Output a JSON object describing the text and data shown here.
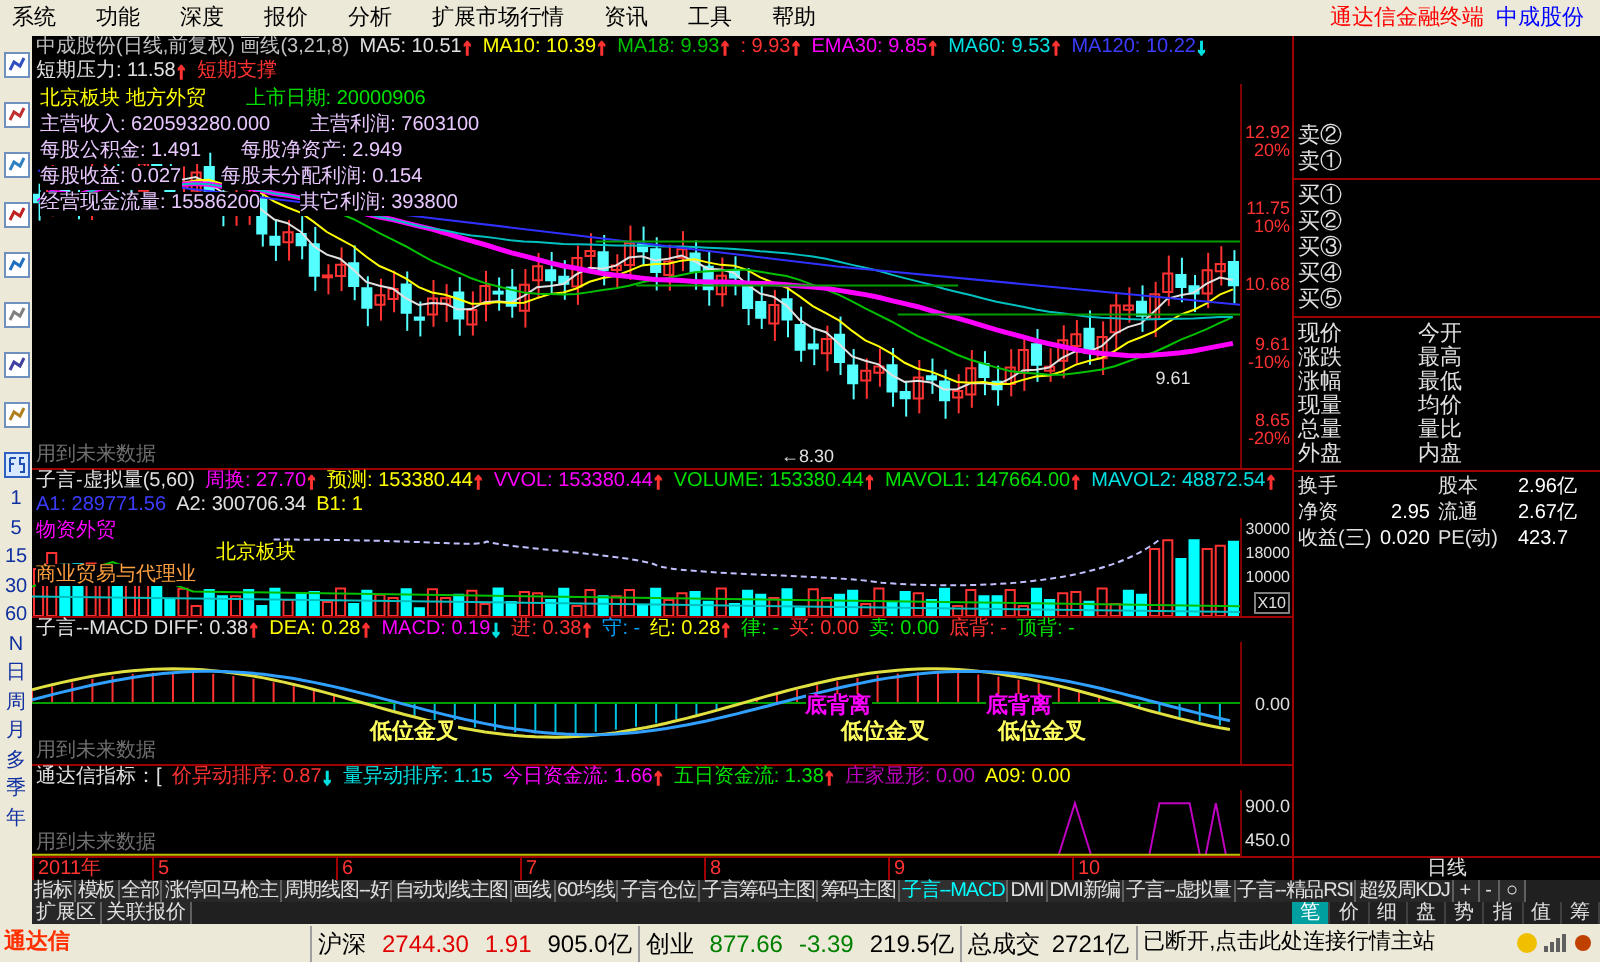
{
  "menu": [
    "系统",
    "功能",
    "深度",
    "报价",
    "分析",
    "扩展市场行情",
    "资讯",
    "工具",
    "帮助"
  ],
  "brand": {
    "terminal": "通达信金融终端",
    "stock": "中成股份"
  },
  "left_toolbar": {
    "periods": [
      "1",
      "5",
      "15",
      "30",
      "60",
      "N",
      "日",
      "周",
      "月",
      "多",
      "季",
      "年"
    ]
  },
  "main_chart": {
    "header": [
      {
        "text": "中成股份(日线,前复权) 画线(3,21,8)",
        "color": "#c0c0c0"
      },
      {
        "text": "MA5: 10.51",
        "color": "#e0e0e0",
        "arrow": {
          "text": "↑",
          "color": "#ff3232"
        }
      },
      {
        "text": "MA10: 10.39",
        "color": "#ffff00",
        "arrow": {
          "text": "↑",
          "color": "#ff3232"
        }
      },
      {
        "text": "MA18: 9.93",
        "color": "#00c000",
        "arrow": {
          "text": "↑",
          "color": "#ff3232"
        }
      },
      {
        "text": ": 9.93",
        "color": "#ff3232",
        "arrow": {
          "text": "↑",
          "color": "#ff3232"
        }
      },
      {
        "text": "EMA30: 9.85",
        "color": "#ff00ff",
        "arrow": {
          "text": "↑",
          "color": "#ff3232"
        }
      },
      {
        "text": "MA60: 9.53",
        "color": "#00e0e0",
        "arrow": {
          "text": "↑",
          "color": "#ff3232"
        }
      },
      {
        "text": "MA120: 10.22",
        "color": "#3c3cff",
        "arrow": {
          "text": "↓",
          "color": "#00e0e0"
        }
      },
      {
        "text": "短期压力: 11.58",
        "color": "#e0e0e0",
        "arrow": {
          "text": "↑",
          "color": "#ff3232"
        }
      },
      {
        "text": "短期支撑",
        "color": "#ff3232"
      }
    ],
    "info": [
      [
        {
          "text": "北京板块 地方外贸",
          "color": "#ffff00"
        },
        {
          "text": "上市日期: 20000906",
          "color": "#00e000"
        }
      ],
      [
        {
          "text": "主营收入: 620593280.000",
          "color": "#e8c8ff"
        },
        {
          "text": "主营利润: 7603100",
          "color": "#e8c8ff"
        }
      ],
      [
        {
          "text": "每股公积金: 1.491",
          "color": "#e8c8ff"
        },
        {
          "text": "每股净资产: 2.949",
          "color": "#e8c8ff"
        }
      ],
      [
        {
          "text": "每股收益: 0.027",
          "color": "#e8c8ff"
        },
        {
          "text": "每股未分配利润: 0.154",
          "color": "#e8c8ff"
        }
      ],
      [
        {
          "text": "经营现金流量: 15586200",
          "color": "#e8c8ff"
        },
        {
          "text": "其它利润: 393800",
          "color": "#e8c8ff"
        }
      ]
    ],
    "axis": [
      {
        "price": "12.92",
        "pct": "20%"
      },
      {
        "price": "11.75",
        "pct": "10%"
      },
      {
        "price": "10.68"
      },
      {
        "price": "9.61",
        "pct": "-10%"
      },
      {
        "price": "8.65",
        "pct": "-20%"
      }
    ],
    "low_marker": "←8.30",
    "last_marker": "9.61",
    "note": "用到未来数据"
  },
  "volume": {
    "header": [
      {
        "text": "子言-虚拟量(5,60)",
        "color": "#e0e0e0"
      },
      {
        "text": "周换: 27.70",
        "color": "#ff00ff",
        "arrow": {
          "text": "↑",
          "color": "#ff3232"
        }
      },
      {
        "text": "预测: 153380.44",
        "color": "#ffff00",
        "arrow": {
          "text": "↑",
          "color": "#ff3232"
        }
      },
      {
        "text": "VVOL: 153380.44",
        "color": "#ff00ff",
        "arrow": {
          "text": "↑",
          "color": "#ff3232"
        }
      },
      {
        "text": "VOLUME: 153380.44",
        "color": "#00e000",
        "arrow": {
          "text": "↑",
          "color": "#ff3232"
        }
      },
      {
        "text": "MAVOL1: 147664.00",
        "color": "#00e000",
        "arrow": {
          "text": "↑",
          "color": "#ff3232"
        }
      },
      {
        "text": "MAVOL2: 48872.54",
        "color": "#00e0e0",
        "arrow": {
          "text": "↑",
          "color": "#ff3232"
        }
      },
      {
        "text": "A1: 289771.56",
        "color": "#3c3cff"
      },
      {
        "text": "A2: 300706.34",
        "color": "#e0e0e0"
      },
      {
        "text": "B1: 1",
        "color": "#ffff00"
      }
    ],
    "overlay": [
      {
        "text": "物资外贸",
        "color": "#ff00ff"
      },
      {
        "text": "北京板块",
        "color": "#ffff00"
      },
      {
        "text": "商业贸易与代理业",
        "color": "#ffa040"
      }
    ],
    "axis": [
      "30000",
      "18000",
      "10000"
    ],
    "unit": "X10"
  },
  "macd": {
    "header": [
      {
        "text": "子言--MACD DIFF: 0.38",
        "color": "#e0e0e0",
        "arrow": {
          "text": "↑",
          "color": "#ff3232"
        }
      },
      {
        "text": "DEA: 0.28",
        "color": "#ffff00",
        "arrow": {
          "text": "↑",
          "color": "#ff3232"
        }
      },
      {
        "text": "MACD: 0.19",
        "color": "#ff00ff",
        "arrow": {
          "text": "↓",
          "color": "#00e0e0"
        }
      },
      {
        "text": "进: 0.38",
        "color": "#ff3232",
        "arrow": {
          "text": "↑",
          "color": "#ff3232"
        }
      },
      {
        "text": "守: -",
        "color": "#00a0ff"
      },
      {
        "text": "纪: 0.28",
        "color": "#ffff00",
        "arrow": {
          "text": "↑",
          "color": "#ff3232"
        }
      },
      {
        "text": "律: -",
        "color": "#00e000"
      },
      {
        "text": "买: 0.00",
        "color": "#ff3232"
      },
      {
        "text": "卖: 0.00",
        "color": "#00e000"
      },
      {
        "text": "底背: -",
        "color": "#ff3232"
      },
      {
        "text": "顶背: -",
        "color": "#00e000"
      }
    ],
    "labels": [
      {
        "text": "低位金叉",
        "color": "#ffff60"
      },
      {
        "text": "底背离",
        "color": "#ff00ff"
      },
      {
        "text": "低位金叉",
        "color": "#ffff60"
      },
      {
        "text": "底背离",
        "color": "#ff00ff"
      },
      {
        "text": "低位金叉",
        "color": "#ffff60"
      }
    ],
    "axis": [
      "0.00"
    ],
    "note": "用到未来数据"
  },
  "tdx": {
    "header": [
      {
        "text": "通达信指标：[",
        "color": "#e0e0e0"
      },
      {
        "text": "价异动排序: 0.87",
        "color": "#ff3232",
        "arrow": {
          "text": "↓",
          "color": "#00e0e0"
        }
      },
      {
        "text": "量异动排序: 1.15",
        "color": "#00e0e0"
      },
      {
        "text": "今日资金流: 1.66",
        "color": "#ff00ff",
        "arrow": {
          "text": "↑",
          "color": "#ff3232"
        }
      },
      {
        "text": "五日资金流: 1.38",
        "color": "#00e000",
        "arrow": {
          "text": "↑",
          "color": "#ff3232"
        }
      },
      {
        "text": "庄家显形: 0.00",
        "color": "#c000c0"
      },
      {
        "text": "A09: 0.00",
        "color": "#ffff00"
      }
    ],
    "axis": [
      "900.0",
      "450.0"
    ],
    "note": "用到未来数据"
  },
  "dates": [
    "2011年",
    "5",
    "6",
    "7",
    "8",
    "9",
    "10"
  ],
  "period_label": "日线",
  "tabs": [
    {
      "label": "指标",
      "selected": false
    },
    {
      "label": "模板",
      "selected": false
    },
    {
      "label": "全部",
      "selected": false
    },
    {
      "label": "涨停回马枪主",
      "selected": false
    },
    {
      "label": "周期线图--好",
      "selected": false
    },
    {
      "label": "自动划线主图",
      "selected": false
    },
    {
      "label": "画线",
      "selected": false
    },
    {
      "label": "60均线",
      "selected": false
    },
    {
      "label": "子言仓位",
      "selected": false
    },
    {
      "label": "子言筹码主图",
      "selected": false
    },
    {
      "label": "筹码主图",
      "selected": false
    },
    {
      "label": "子言--MACD",
      "selected": true
    },
    {
      "label": "DMI",
      "selected": false
    },
    {
      "label": "DMI新编",
      "selected": false
    },
    {
      "label": "子言--虚拟量",
      "selected": false
    },
    {
      "label": "子言--精品RSI",
      "selected": false
    },
    {
      "label": "超级周KDJ",
      "selected": false
    }
  ],
  "zoom_buttons": [
    "+",
    "-",
    "○"
  ],
  "sub_tabs": [
    "扩展区",
    "关联报价"
  ],
  "quote": {
    "sell": [
      "卖②",
      "卖①"
    ],
    "buy": [
      "买①",
      "买②",
      "买③",
      "买④",
      "买⑤"
    ],
    "fields": [
      [
        "现价",
        "今开"
      ],
      [
        "涨跌",
        "最高"
      ],
      [
        "涨幅",
        "最低"
      ],
      [
        "现量",
        "均价"
      ],
      [
        "总量",
        "量比"
      ],
      [
        "外盘",
        "内盘"
      ]
    ],
    "stats": [
      {
        "label": "换手",
        "label2": "股本",
        "value2": "2.96亿"
      },
      {
        "label": "净资",
        "value": "2.95",
        "label2": "流通",
        "value2": "2.67亿"
      },
      {
        "label": "收益(三)",
        "value": "0.020",
        "label2": "PE(动)",
        "value2": "423.7"
      }
    ]
  },
  "side_tabs": [
    {
      "label": "笔",
      "selected": true
    },
    {
      "label": "价",
      "selected": false
    },
    {
      "label": "细",
      "selected": false
    },
    {
      "label": "盘",
      "selected": false
    },
    {
      "label": "势",
      "selected": false
    },
    {
      "label": "指",
      "selected": false
    },
    {
      "label": "值",
      "selected": false
    },
    {
      "label": "筹",
      "selected": false
    }
  ],
  "status": {
    "brand": "通达信",
    "markets": [
      {
        "name": "沪深",
        "index": "2744.30",
        "change": "1.91",
        "amount": "905.0亿",
        "color": "#e00000"
      },
      {
        "name": "创业",
        "index": "877.66",
        "change": "-3.39",
        "amount": "219.5亿",
        "color": "#008000"
      }
    ],
    "total": {
      "label": "总成交",
      "value": "2721亿"
    },
    "message": "已断开,点击此处连接行情主站"
  }
}
